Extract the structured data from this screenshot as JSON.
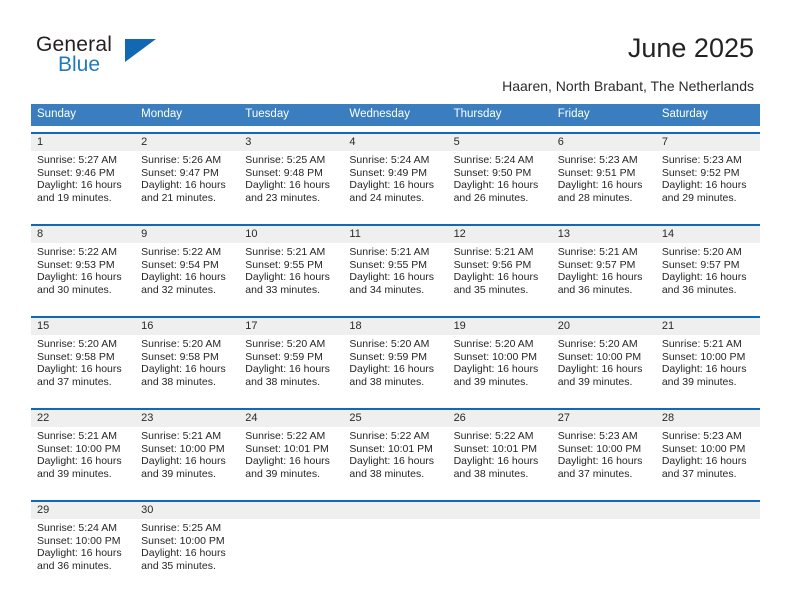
{
  "brand": {
    "name_top": "General",
    "name_bottom": "Blue",
    "accent_color": "#1268b3"
  },
  "header": {
    "title": "June 2025",
    "subtitle": "Haaren, North Brabant, The Netherlands"
  },
  "calendar": {
    "header_bg": "#3b7ec0",
    "row_border_color": "#1268b3",
    "day_band_bg": "#efefef",
    "weekdays": [
      "Sunday",
      "Monday",
      "Tuesday",
      "Wednesday",
      "Thursday",
      "Friday",
      "Saturday"
    ],
    "weeks": [
      [
        {
          "day": "1",
          "sunrise": "Sunrise: 5:27 AM",
          "sunset": "Sunset: 9:46 PM",
          "daylight_line1": "Daylight: 16 hours",
          "daylight_line2": "and 19 minutes."
        },
        {
          "day": "2",
          "sunrise": "Sunrise: 5:26 AM",
          "sunset": "Sunset: 9:47 PM",
          "daylight_line1": "Daylight: 16 hours",
          "daylight_line2": "and 21 minutes."
        },
        {
          "day": "3",
          "sunrise": "Sunrise: 5:25 AM",
          "sunset": "Sunset: 9:48 PM",
          "daylight_line1": "Daylight: 16 hours",
          "daylight_line2": "and 23 minutes."
        },
        {
          "day": "4",
          "sunrise": "Sunrise: 5:24 AM",
          "sunset": "Sunset: 9:49 PM",
          "daylight_line1": "Daylight: 16 hours",
          "daylight_line2": "and 24 minutes."
        },
        {
          "day": "5",
          "sunrise": "Sunrise: 5:24 AM",
          "sunset": "Sunset: 9:50 PM",
          "daylight_line1": "Daylight: 16 hours",
          "daylight_line2": "and 26 minutes."
        },
        {
          "day": "6",
          "sunrise": "Sunrise: 5:23 AM",
          "sunset": "Sunset: 9:51 PM",
          "daylight_line1": "Daylight: 16 hours",
          "daylight_line2": "and 28 minutes."
        },
        {
          "day": "7",
          "sunrise": "Sunrise: 5:23 AM",
          "sunset": "Sunset: 9:52 PM",
          "daylight_line1": "Daylight: 16 hours",
          "daylight_line2": "and 29 minutes."
        }
      ],
      [
        {
          "day": "8",
          "sunrise": "Sunrise: 5:22 AM",
          "sunset": "Sunset: 9:53 PM",
          "daylight_line1": "Daylight: 16 hours",
          "daylight_line2": "and 30 minutes."
        },
        {
          "day": "9",
          "sunrise": "Sunrise: 5:22 AM",
          "sunset": "Sunset: 9:54 PM",
          "daylight_line1": "Daylight: 16 hours",
          "daylight_line2": "and 32 minutes."
        },
        {
          "day": "10",
          "sunrise": "Sunrise: 5:21 AM",
          "sunset": "Sunset: 9:55 PM",
          "daylight_line1": "Daylight: 16 hours",
          "daylight_line2": "and 33 minutes."
        },
        {
          "day": "11",
          "sunrise": "Sunrise: 5:21 AM",
          "sunset": "Sunset: 9:55 PM",
          "daylight_line1": "Daylight: 16 hours",
          "daylight_line2": "and 34 minutes."
        },
        {
          "day": "12",
          "sunrise": "Sunrise: 5:21 AM",
          "sunset": "Sunset: 9:56 PM",
          "daylight_line1": "Daylight: 16 hours",
          "daylight_line2": "and 35 minutes."
        },
        {
          "day": "13",
          "sunrise": "Sunrise: 5:21 AM",
          "sunset": "Sunset: 9:57 PM",
          "daylight_line1": "Daylight: 16 hours",
          "daylight_line2": "and 36 minutes."
        },
        {
          "day": "14",
          "sunrise": "Sunrise: 5:20 AM",
          "sunset": "Sunset: 9:57 PM",
          "daylight_line1": "Daylight: 16 hours",
          "daylight_line2": "and 36 minutes."
        }
      ],
      [
        {
          "day": "15",
          "sunrise": "Sunrise: 5:20 AM",
          "sunset": "Sunset: 9:58 PM",
          "daylight_line1": "Daylight: 16 hours",
          "daylight_line2": "and 37 minutes."
        },
        {
          "day": "16",
          "sunrise": "Sunrise: 5:20 AM",
          "sunset": "Sunset: 9:58 PM",
          "daylight_line1": "Daylight: 16 hours",
          "daylight_line2": "and 38 minutes."
        },
        {
          "day": "17",
          "sunrise": "Sunrise: 5:20 AM",
          "sunset": "Sunset: 9:59 PM",
          "daylight_line1": "Daylight: 16 hours",
          "daylight_line2": "and 38 minutes."
        },
        {
          "day": "18",
          "sunrise": "Sunrise: 5:20 AM",
          "sunset": "Sunset: 9:59 PM",
          "daylight_line1": "Daylight: 16 hours",
          "daylight_line2": "and 38 minutes."
        },
        {
          "day": "19",
          "sunrise": "Sunrise: 5:20 AM",
          "sunset": "Sunset: 10:00 PM",
          "daylight_line1": "Daylight: 16 hours",
          "daylight_line2": "and 39 minutes."
        },
        {
          "day": "20",
          "sunrise": "Sunrise: 5:20 AM",
          "sunset": "Sunset: 10:00 PM",
          "daylight_line1": "Daylight: 16 hours",
          "daylight_line2": "and 39 minutes."
        },
        {
          "day": "21",
          "sunrise": "Sunrise: 5:21 AM",
          "sunset": "Sunset: 10:00 PM",
          "daylight_line1": "Daylight: 16 hours",
          "daylight_line2": "and 39 minutes."
        }
      ],
      [
        {
          "day": "22",
          "sunrise": "Sunrise: 5:21 AM",
          "sunset": "Sunset: 10:00 PM",
          "daylight_line1": "Daylight: 16 hours",
          "daylight_line2": "and 39 minutes."
        },
        {
          "day": "23",
          "sunrise": "Sunrise: 5:21 AM",
          "sunset": "Sunset: 10:00 PM",
          "daylight_line1": "Daylight: 16 hours",
          "daylight_line2": "and 39 minutes."
        },
        {
          "day": "24",
          "sunrise": "Sunrise: 5:22 AM",
          "sunset": "Sunset: 10:01 PM",
          "daylight_line1": "Daylight: 16 hours",
          "daylight_line2": "and 39 minutes."
        },
        {
          "day": "25",
          "sunrise": "Sunrise: 5:22 AM",
          "sunset": "Sunset: 10:01 PM",
          "daylight_line1": "Daylight: 16 hours",
          "daylight_line2": "and 38 minutes."
        },
        {
          "day": "26",
          "sunrise": "Sunrise: 5:22 AM",
          "sunset": "Sunset: 10:01 PM",
          "daylight_line1": "Daylight: 16 hours",
          "daylight_line2": "and 38 minutes."
        },
        {
          "day": "27",
          "sunrise": "Sunrise: 5:23 AM",
          "sunset": "Sunset: 10:00 PM",
          "daylight_line1": "Daylight: 16 hours",
          "daylight_line2": "and 37 minutes."
        },
        {
          "day": "28",
          "sunrise": "Sunrise: 5:23 AM",
          "sunset": "Sunset: 10:00 PM",
          "daylight_line1": "Daylight: 16 hours",
          "daylight_line2": "and 37 minutes."
        }
      ],
      [
        {
          "day": "29",
          "sunrise": "Sunrise: 5:24 AM",
          "sunset": "Sunset: 10:00 PM",
          "daylight_line1": "Daylight: 16 hours",
          "daylight_line2": "and 36 minutes."
        },
        {
          "day": "30",
          "sunrise": "Sunrise: 5:25 AM",
          "sunset": "Sunset: 10:00 PM",
          "daylight_line1": "Daylight: 16 hours",
          "daylight_line2": "and 35 minutes."
        },
        {
          "day": "",
          "sunrise": "",
          "sunset": "",
          "daylight_line1": "",
          "daylight_line2": ""
        },
        {
          "day": "",
          "sunrise": "",
          "sunset": "",
          "daylight_line1": "",
          "daylight_line2": ""
        },
        {
          "day": "",
          "sunrise": "",
          "sunset": "",
          "daylight_line1": "",
          "daylight_line2": ""
        },
        {
          "day": "",
          "sunrise": "",
          "sunset": "",
          "daylight_line1": "",
          "daylight_line2": ""
        },
        {
          "day": "",
          "sunrise": "",
          "sunset": "",
          "daylight_line1": "",
          "daylight_line2": ""
        }
      ]
    ]
  }
}
